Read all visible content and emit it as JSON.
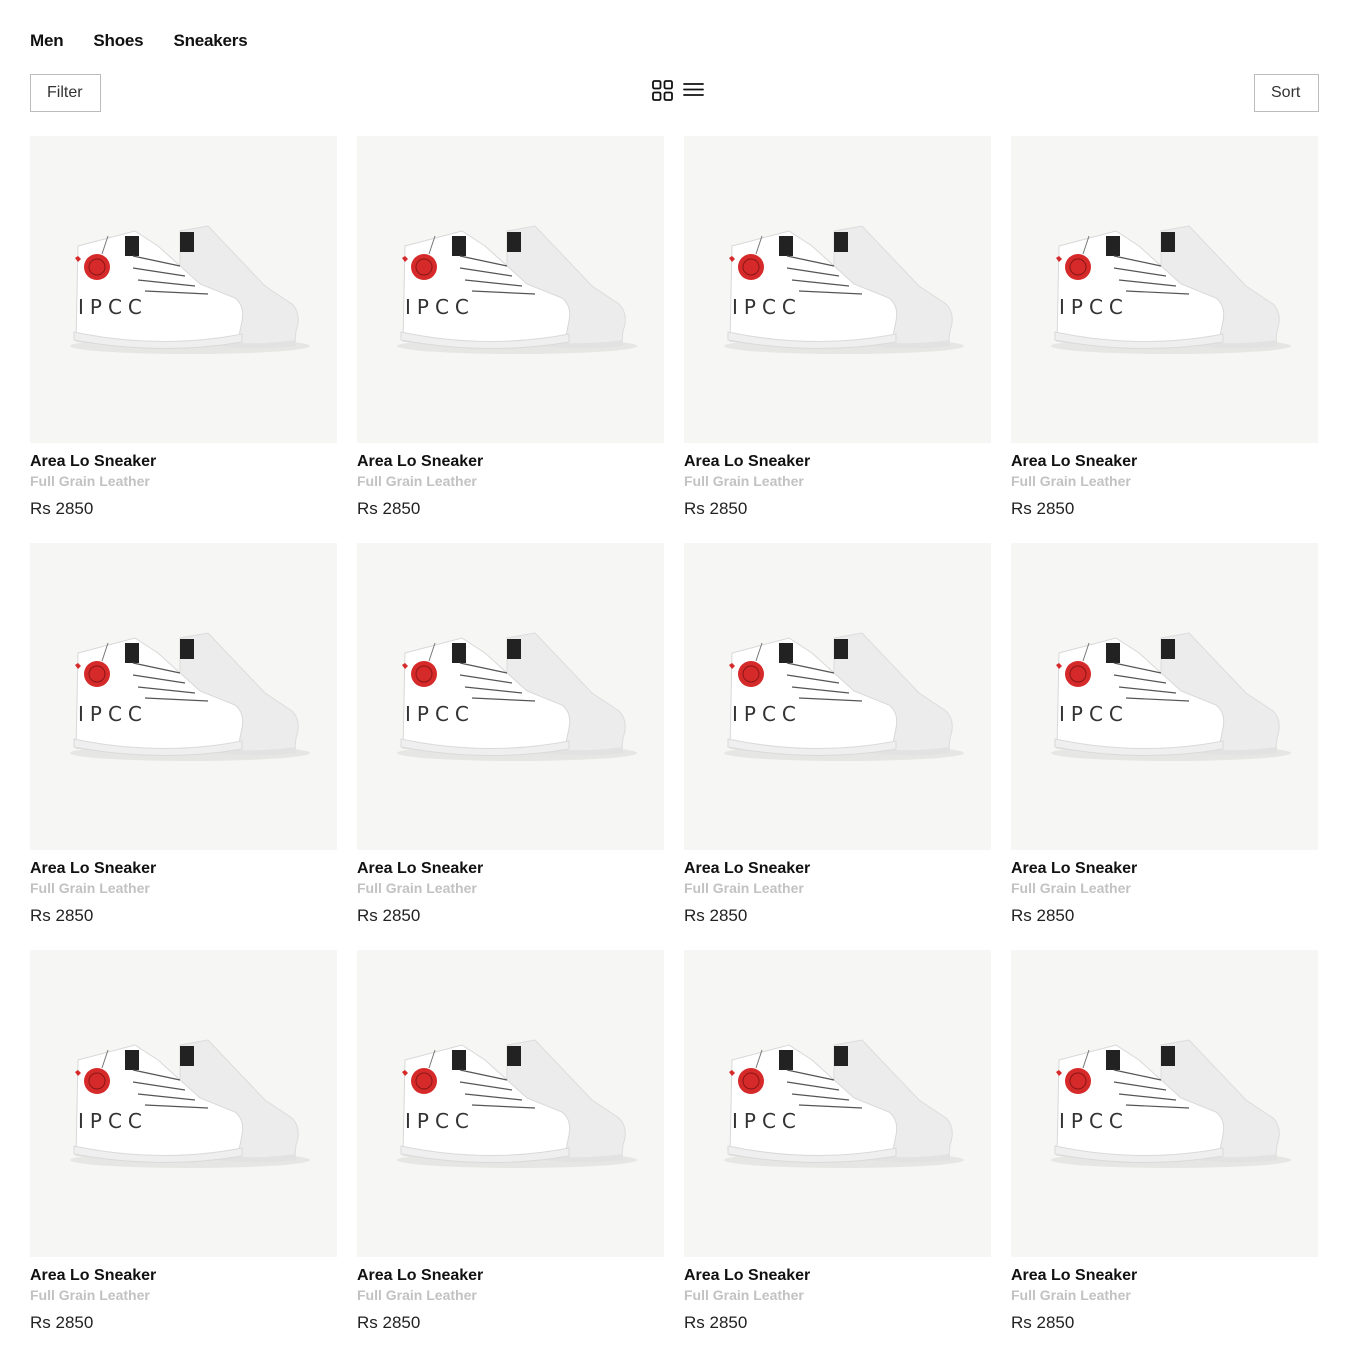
{
  "breadcrumb": [
    "Men",
    "Shoes",
    "Sneakers"
  ],
  "toolbar": {
    "filter_label": "Filter",
    "sort_label": "Sort",
    "grid_view_icon": "grid-view-icon",
    "list_view_icon": "list-view-icon"
  },
  "products": [
    {
      "title": "Area Lo Sneaker",
      "subtitle": "Full Grain Leather",
      "price": "Rs 2850"
    },
    {
      "title": "Area Lo Sneaker",
      "subtitle": "Full Grain Leather",
      "price": "Rs 2850"
    },
    {
      "title": "Area Lo Sneaker",
      "subtitle": "Full Grain Leather",
      "price": "Rs 2850"
    },
    {
      "title": "Area Lo Sneaker",
      "subtitle": "Full Grain Leather",
      "price": "Rs 2850"
    },
    {
      "title": "Area Lo Sneaker",
      "subtitle": "Full Grain Leather",
      "price": "Rs 2850"
    },
    {
      "title": "Area Lo Sneaker",
      "subtitle": "Full Grain Leather",
      "price": "Rs 2850"
    },
    {
      "title": "Area Lo Sneaker",
      "subtitle": "Full Grain Leather",
      "price": "Rs 2850"
    },
    {
      "title": "Area Lo Sneaker",
      "subtitle": "Full Grain Leather",
      "price": "Rs 2850"
    },
    {
      "title": "Area Lo Sneaker",
      "subtitle": "Full Grain Leather",
      "price": "Rs 2850"
    },
    {
      "title": "Area Lo Sneaker",
      "subtitle": "Full Grain Leather",
      "price": "Rs 2850"
    },
    {
      "title": "Area Lo Sneaker",
      "subtitle": "Full Grain Leather",
      "price": "Rs 2850"
    },
    {
      "title": "Area Lo Sneaker",
      "subtitle": "Full Grain Leather",
      "price": "Rs 2850"
    }
  ],
  "colors": {
    "image_bg": "#f6f6f5",
    "subtitle": "#c2c2c2",
    "tag_red": "#d62a2a",
    "border": "#bcbcbc"
  }
}
